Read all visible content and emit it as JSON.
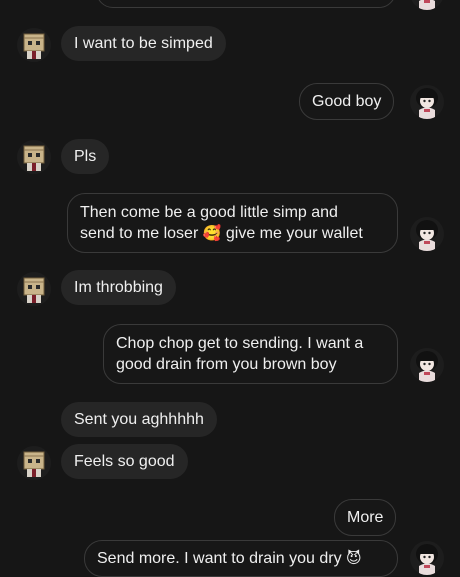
{
  "messages": [
    {
      "text": "I want to be simped"
    },
    {
      "text": "Good boy"
    },
    {
      "text": "Pls"
    },
    {
      "line1": "Then come be a good little simp and",
      "line2_before": "send to me loser",
      "emoji": "🥰",
      "line2_after": "give me your wallet"
    },
    {
      "text": "Im throbbing"
    },
    {
      "line1": "Chop chop get to sending. I want a",
      "line2": "good drain from you brown boy"
    },
    {
      "text": "Sent you aghhhhh"
    },
    {
      "text": "Feels so good"
    },
    {
      "text": "More"
    },
    {
      "text_before": "Send more. I want to drain you dry",
      "emoji": "😈"
    }
  ],
  "colors": {
    "background": "#161616",
    "incoming_bubble": "#262626",
    "outgoing_bubble_border": "#3a3a3a",
    "text": "#efefef"
  },
  "icons": {
    "sender_avatar": "box-head-character-avatar",
    "receiver_avatar": "anime-girl-avatar"
  }
}
